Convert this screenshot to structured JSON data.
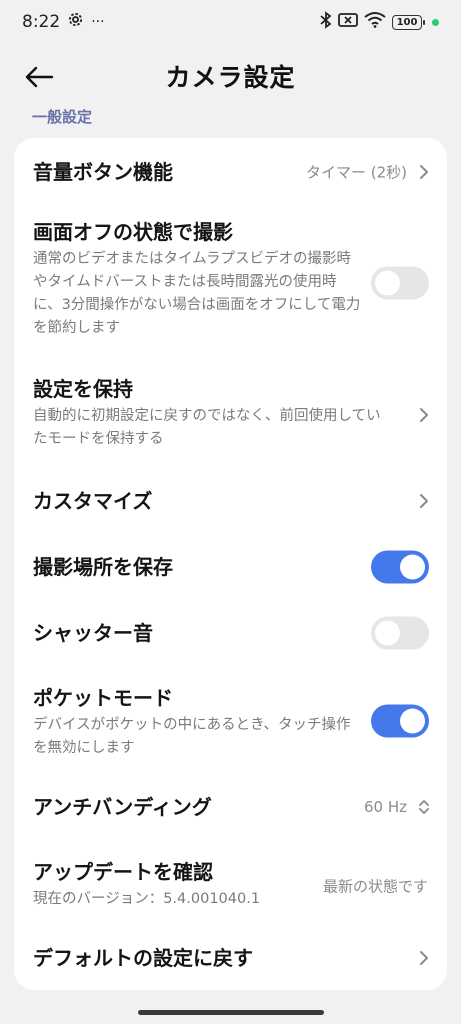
{
  "status_bar": {
    "time": "8:22",
    "more": "···",
    "battery": "100"
  },
  "app_bar": {
    "title": "カメラ設定"
  },
  "section": {
    "header": "一般設定"
  },
  "items": [
    {
      "title": "音量ボタン機能",
      "value": "タイマー (2秒)"
    },
    {
      "title": "画面オフの状態で撮影",
      "subtitle": "通常のビデオまたはタイムラプスビデオの撮影時やタイムドバーストまたは長時間露光の使用時に、3分間操作がない場合は画面をオフにして電力を節約します",
      "toggle": "off"
    },
    {
      "title": "設定を保持",
      "subtitle": "自動的に初期設定に戻すのではなく、前回使用していたモードを保持する"
    },
    {
      "title": "カスタマイズ"
    },
    {
      "title": "撮影場所を保存",
      "toggle": "on"
    },
    {
      "title": "シャッター音",
      "toggle": "off"
    },
    {
      "title": "ポケットモード",
      "subtitle": "デバイスがポケットの中にあるとき、タッチ操作を無効にします",
      "toggle": "on"
    },
    {
      "title": "アンチバンディング",
      "value": "60 Hz"
    },
    {
      "title": "アップデートを確認",
      "subtitle": "現在のバージョン：5.4.001040.1",
      "value": "最新の状態です"
    },
    {
      "title": "デフォルトの設定に戻す"
    }
  ],
  "colors": {
    "accent": "#4479ec",
    "section_header": "#6a72a8",
    "background": "#f1f1f3"
  }
}
